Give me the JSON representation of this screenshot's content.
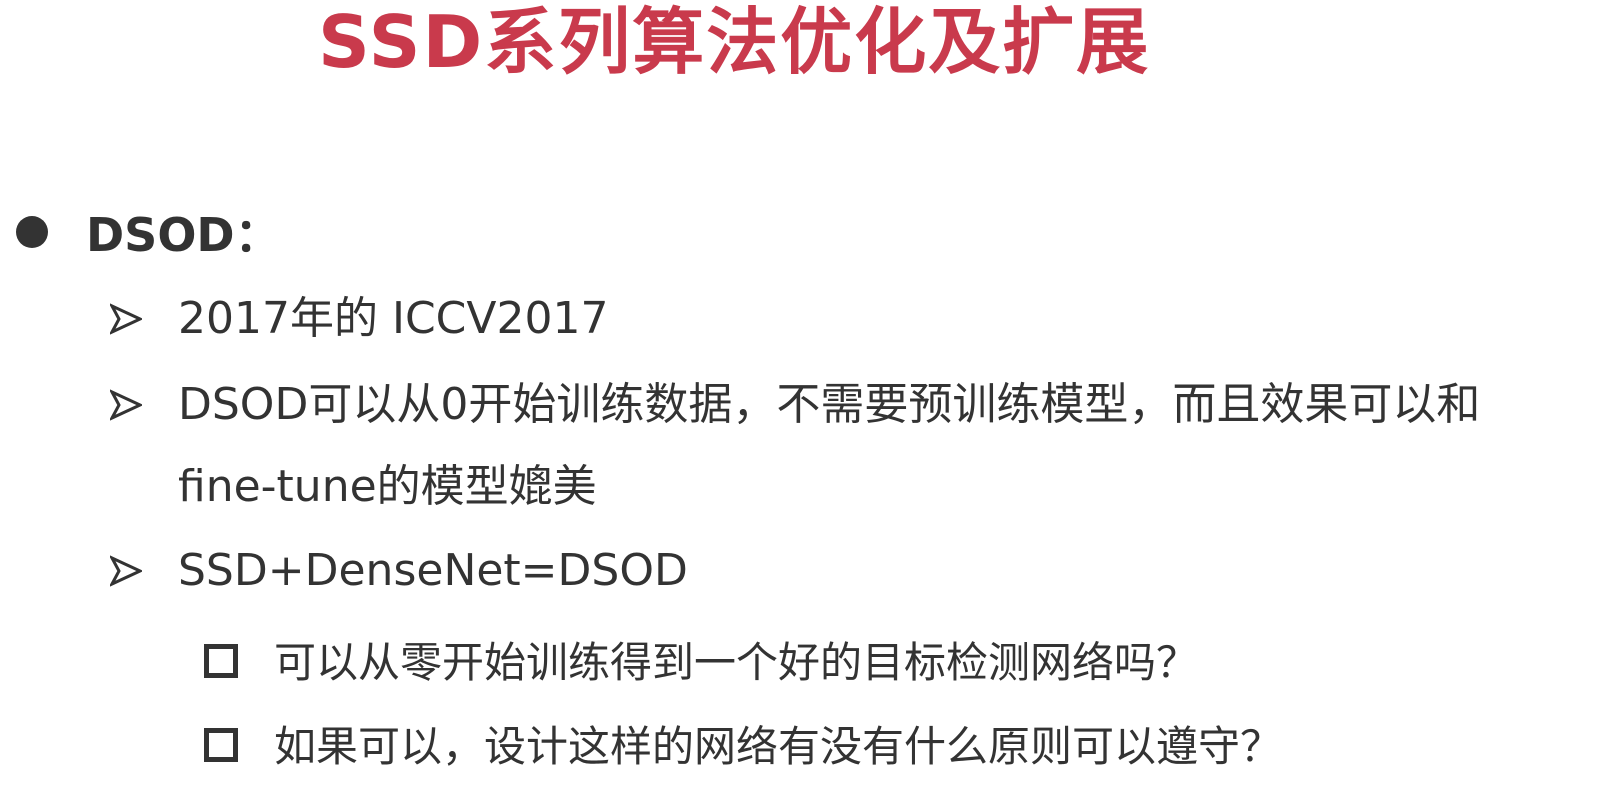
{
  "slide": {
    "title": "SSD系列算法优化及扩展"
  },
  "bullets": {
    "main": "DSOD：",
    "items": [
      {
        "text": "2017年的 ICCV2017"
      },
      {
        "text_line1": "DSOD可以从0开始训练数据，不需要预训练模型，而且效果可以和",
        "text_line2": "fine-tune的模型媲美"
      },
      {
        "text": "SSD+DenseNet=DSOD"
      }
    ],
    "sub_items": [
      {
        "text": "可以从零开始训练得到一个好的目标检测网络吗？"
      },
      {
        "text": "如果可以，设计这样的网络有没有什么原则可以遵守？"
      }
    ]
  },
  "colors": {
    "title": "#c93a4c",
    "body_text": "#333333",
    "background": "#ffffff"
  },
  "icons": {
    "main_bullet": "filled-circle-icon",
    "level2_bullet": "arrowhead-icon",
    "level3_bullet": "hollow-square-icon"
  }
}
